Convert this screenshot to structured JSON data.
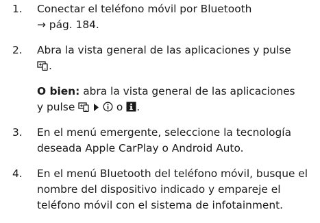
{
  "steps": [
    {
      "num": "1.",
      "line1": "Conectar el teléfono móvil por Bluetooth",
      "ref_arrow": "→",
      "ref_text": " pág. 184."
    },
    {
      "num": "2.",
      "text": "Abra la vista general de las aplicaciones y pulse",
      "icon": "phone-app-icon",
      "end": ".",
      "alt_label": "O bien:",
      "alt_text": " abra la vista general de las aplicaciones y pulse ",
      "alt_icons": [
        "phone-app-icon",
        "triangle-right-icon",
        "info-circle-icon",
        "info-square-icon"
      ],
      "alt_conj": " o ",
      "alt_end": "."
    },
    {
      "num": "3.",
      "text": "En el menú emergente, seleccione la tecnología deseada Apple CarPlay o Android Auto."
    },
    {
      "num": "4.",
      "text": "En el menú Bluetooth del teléfono móvil, busque el nombre del dispositivo indicado y empareje el teléfono móvil con el sistema de infotainment."
    }
  ]
}
